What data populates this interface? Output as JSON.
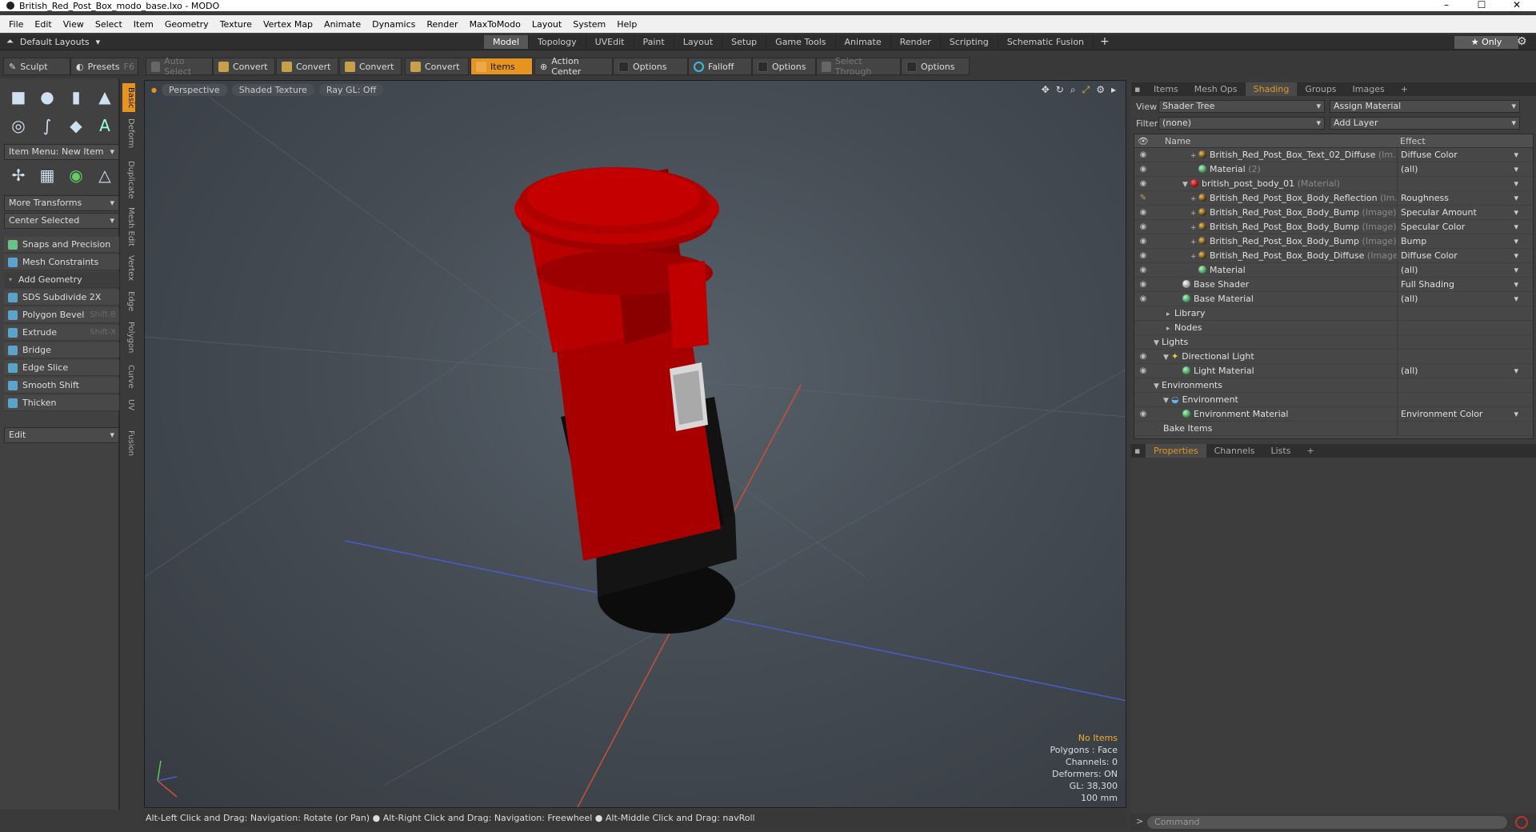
{
  "window": {
    "title": "British_Red_Post_Box_modo_base.lxo - MODO",
    "controls": [
      "–",
      "☐",
      "✕"
    ]
  },
  "menu": [
    "File",
    "Edit",
    "View",
    "Select",
    "Item",
    "Geometry",
    "Texture",
    "Vertex Map",
    "Animate",
    "Dynamics",
    "Render",
    "MaxToModo",
    "Layout",
    "System",
    "Help"
  ],
  "modebar": {
    "layouts": "Default Layouts",
    "tabs": [
      "Model",
      "Topology",
      "UVEdit",
      "Paint",
      "Layout",
      "Setup",
      "Game Tools",
      "Animate",
      "Render",
      "Scripting",
      "Schematic Fusion"
    ],
    "active_tab": "Model",
    "only": "★ Only"
  },
  "toolbar": {
    "sculpt": "Sculpt",
    "presets": "Presets",
    "presets_key": "F6",
    "auto_select": "Auto Select",
    "convert": "Convert",
    "items": "Items",
    "action_center": "Action Center",
    "options": "Options",
    "falloff": "Falloff",
    "select_through": "Select Through"
  },
  "left": {
    "item_menu": "Item Menu: New Item",
    "more_transforms": "More Transforms",
    "center_selected": "Center Selected",
    "snaps": "Snaps and Precision",
    "mesh_constraints": "Mesh Constraints",
    "add_geometry": "Add Geometry",
    "tools": [
      {
        "label": "SDS Subdivide 2X",
        "key": ""
      },
      {
        "label": "Polygon Bevel",
        "key": "Shift-B"
      },
      {
        "label": "Extrude",
        "key": "Shift-X"
      },
      {
        "label": "Bridge",
        "key": ""
      },
      {
        "label": "Edge Slice",
        "key": ""
      },
      {
        "label": "Smooth Shift",
        "key": ""
      },
      {
        "label": "Thicken",
        "key": ""
      }
    ],
    "edit": "Edit",
    "vtabs": [
      "Basic",
      "Deform",
      "Duplicate",
      "Mesh Edit",
      "Vertex",
      "Edge",
      "Polygon",
      "Curve",
      "UV",
      "Fusion"
    ]
  },
  "viewport": {
    "perspective": "Perspective",
    "shading": "Shaded Texture",
    "raygl": "Ray GL: Off",
    "stats": {
      "items": "No Items",
      "polygons": "Polygons : Face",
      "channels": "Channels: 0",
      "deformers": "Deformers: ON",
      "gl": "GL: 38,300",
      "grid": "100 mm"
    }
  },
  "status": "Alt-Left Click and Drag: Navigation: Rotate (or Pan) ● Alt-Right Click and Drag: Navigation: Freewheel ● Alt-Middle Click and Drag: navRoll",
  "right": {
    "tabs": [
      "Items",
      "Mesh Ops",
      "Shading",
      "Groups",
      "Images"
    ],
    "active_tab": "Shading",
    "view_label": "View",
    "view_value": "Shader Tree",
    "assign": "Assign Material",
    "filter_label": "Filter",
    "filter_value": "(none)",
    "add_layer": "Add Layer",
    "col_name": "Name",
    "col_effect": "Effect",
    "rows": [
      {
        "name": "British_Red_Post_Box_Text_02_Diffuse",
        "sub": "(Im...",
        "effect": "Diffuse Color"
      },
      {
        "name": "Material",
        "sub": "(2)",
        "effect": "(all)"
      },
      {
        "name": "british_post_body_01",
        "sub": "(Material)",
        "effect": ""
      },
      {
        "name": "British_Red_Post_Box_Body_Reflection",
        "sub": "(Im...",
        "effect": "Roughness"
      },
      {
        "name": "British_Red_Post_Box_Body_Bump",
        "sub": "(Image)",
        "effect": "Specular Amount"
      },
      {
        "name": "British_Red_Post_Box_Body_Bump",
        "sub": "(Image)",
        "effect": "Specular Color"
      },
      {
        "name": "British_Red_Post_Box_Body_Bump",
        "sub": "(Image)",
        "effect": "Bump"
      },
      {
        "name": "British_Red_Post_Box_Body_Diffuse",
        "sub": "(Image)",
        "effect": "Diffuse Color"
      },
      {
        "name": "Material",
        "sub": "",
        "effect": "(all)"
      },
      {
        "name": "Base Shader",
        "sub": "",
        "effect": "Full Shading"
      },
      {
        "name": "Base Material",
        "sub": "",
        "effect": "(all)"
      },
      {
        "name": "Library",
        "sub": "",
        "effect": ""
      },
      {
        "name": "Nodes",
        "sub": "",
        "effect": ""
      },
      {
        "name": "Lights",
        "sub": "",
        "effect": ""
      },
      {
        "name": "Directional Light",
        "sub": "",
        "effect": ""
      },
      {
        "name": "Light Material",
        "sub": "",
        "effect": "(all)"
      },
      {
        "name": "Environments",
        "sub": "",
        "effect": ""
      },
      {
        "name": "Environment",
        "sub": "",
        "effect": ""
      },
      {
        "name": "Environment Material",
        "sub": "",
        "effect": "Environment Color"
      },
      {
        "name": "Bake Items",
        "sub": "",
        "effect": ""
      }
    ],
    "prop_tabs": [
      "Properties",
      "Channels",
      "Lists"
    ],
    "command_placeholder": "Command"
  },
  "colors": {
    "accent": "#e69420",
    "postbox_red": "#b00000"
  }
}
